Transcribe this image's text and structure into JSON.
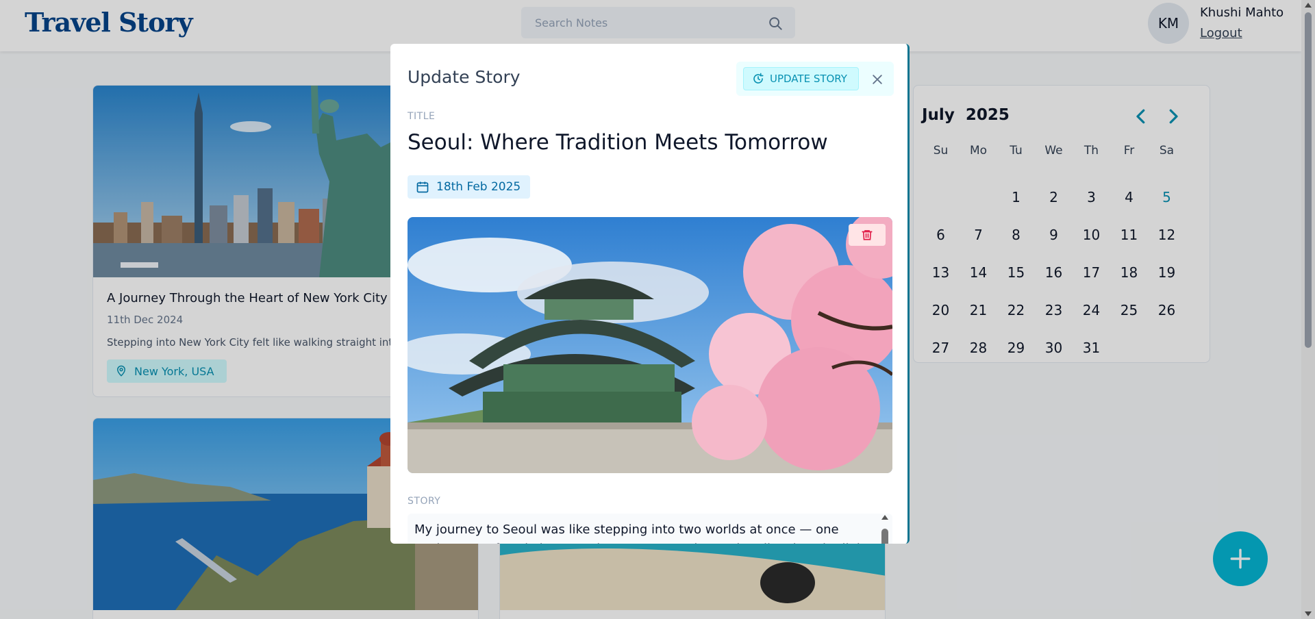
{
  "brand": {
    "logo": "Travel Story"
  },
  "search": {
    "placeholder": "Search Notes"
  },
  "user": {
    "initials": "KM",
    "name": "Khushi Mahto",
    "logout": "Logout"
  },
  "cards": [
    {
      "title": "A Journey Through the Heart of New York City",
      "date": "11th Dec 2024",
      "excerpt": "Stepping into New York City felt like walking straight into",
      "location": "New York, USA"
    }
  ],
  "calendar": {
    "month": "July",
    "year": "2025",
    "weekdays": [
      "Su",
      "Mo",
      "Tu",
      "We",
      "Th",
      "Fr",
      "Sa"
    ],
    "days": [
      [
        "",
        "",
        "1",
        "2",
        "3",
        "4",
        "5"
      ],
      [
        "6",
        "7",
        "8",
        "9",
        "10",
        "11",
        "12"
      ],
      [
        "13",
        "14",
        "15",
        "16",
        "17",
        "18",
        "19"
      ],
      [
        "20",
        "21",
        "22",
        "23",
        "24",
        "25",
        "26"
      ],
      [
        "27",
        "28",
        "29",
        "30",
        "31",
        "",
        ""
      ]
    ],
    "today": "5"
  },
  "fab": {
    "label": "+"
  },
  "modal": {
    "heading": "Update Story",
    "update_label": "UPDATE STORY",
    "title_label": "TITLE",
    "title": "Seoul: Where Tradition Meets Tomorrow",
    "date": "18th Feb 2025",
    "story_label": "STORY",
    "story": "My journey to Seoul was like stepping into two worlds at once — one ancient, one futuristic. From the serene temples to the glittering city lights"
  },
  "colors": {
    "brand": "#05448a",
    "accent": "#06b6d4",
    "accent_text": "#0891b2",
    "danger": "#e11d48"
  },
  "icons": [
    "search-icon",
    "location-icon",
    "chevron-left-icon",
    "chevron-right-icon",
    "plus-icon",
    "refresh-icon",
    "close-icon",
    "calendar-icon",
    "trash-icon"
  ]
}
